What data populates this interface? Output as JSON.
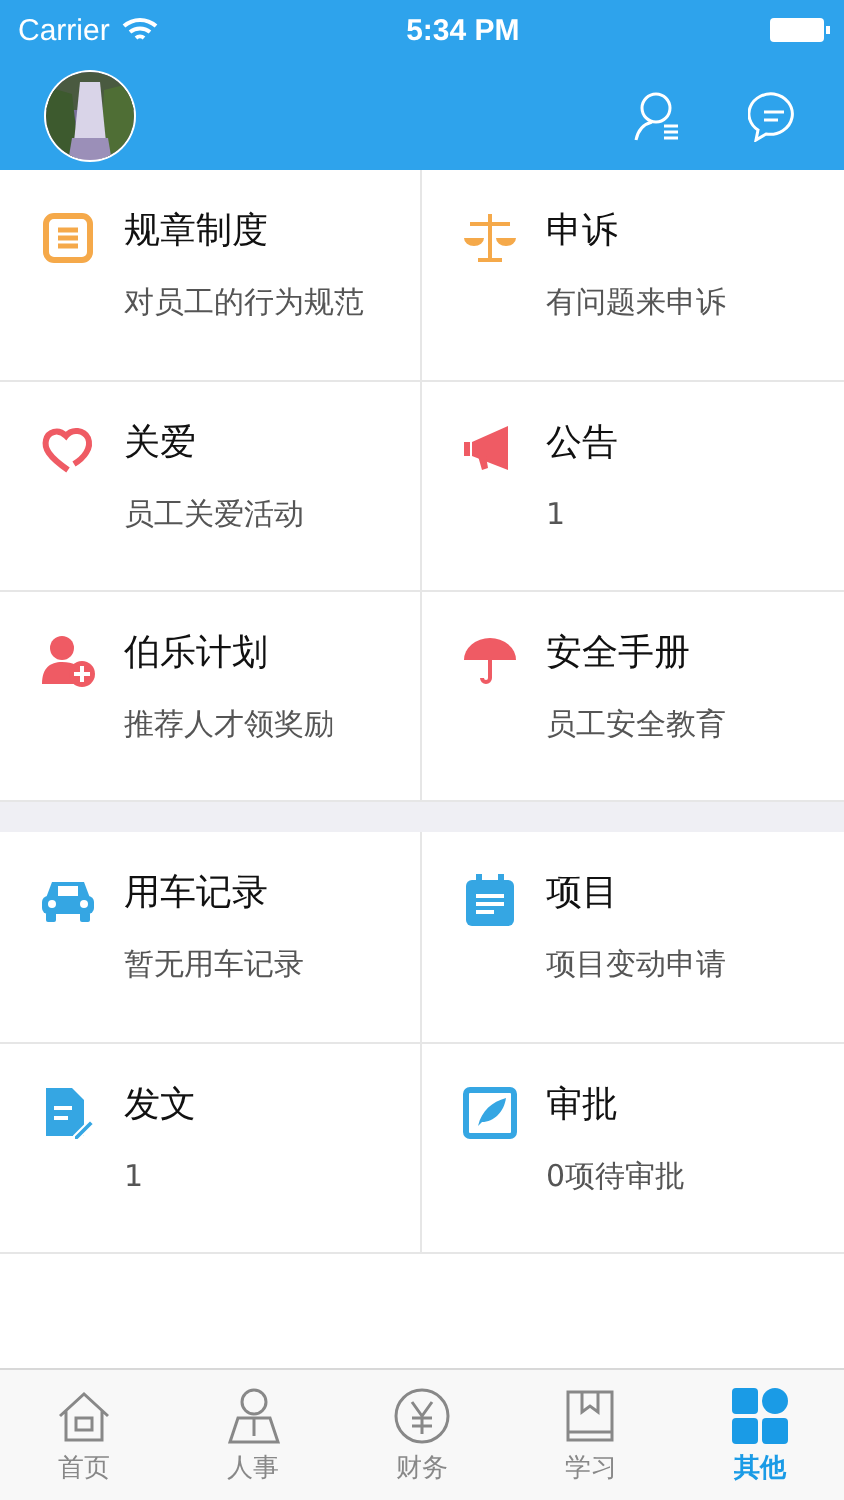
{
  "status_bar": {
    "carrier": "Carrier",
    "time": "5:34 PM"
  },
  "sections": [
    {
      "items": [
        {
          "kind": "rules",
          "title": "规章制度",
          "subtitle": "对员工的行为规范"
        },
        {
          "kind": "appeal",
          "title": "申诉",
          "subtitle": "有问题来申诉"
        },
        {
          "kind": "care",
          "title": "关爱",
          "subtitle": "员工关爱活动"
        },
        {
          "kind": "notice",
          "title": "公告",
          "subtitle": "1"
        },
        {
          "kind": "referral",
          "title": "伯乐计划",
          "subtitle": "推荐人才领奖励"
        },
        {
          "kind": "safety",
          "title": "安全手册",
          "subtitle": "员工安全教育"
        }
      ]
    },
    {
      "items": [
        {
          "kind": "car",
          "title": "用车记录",
          "subtitle": "暂无用车记录"
        },
        {
          "kind": "project",
          "title": "项目",
          "subtitle": "项目变动申请"
        },
        {
          "kind": "document",
          "title": "发文",
          "subtitle": "1"
        },
        {
          "kind": "approval",
          "title": "审批",
          "subtitle": "0项待审批"
        }
      ]
    }
  ],
  "tab_bar": [
    {
      "kind": "home",
      "label": "首页",
      "selected": false
    },
    {
      "kind": "people",
      "label": "人事",
      "selected": false
    },
    {
      "kind": "finance",
      "label": "财务",
      "selected": false
    },
    {
      "kind": "study",
      "label": "学习",
      "selected": false
    },
    {
      "kind": "other",
      "label": "其他",
      "selected": true
    }
  ]
}
